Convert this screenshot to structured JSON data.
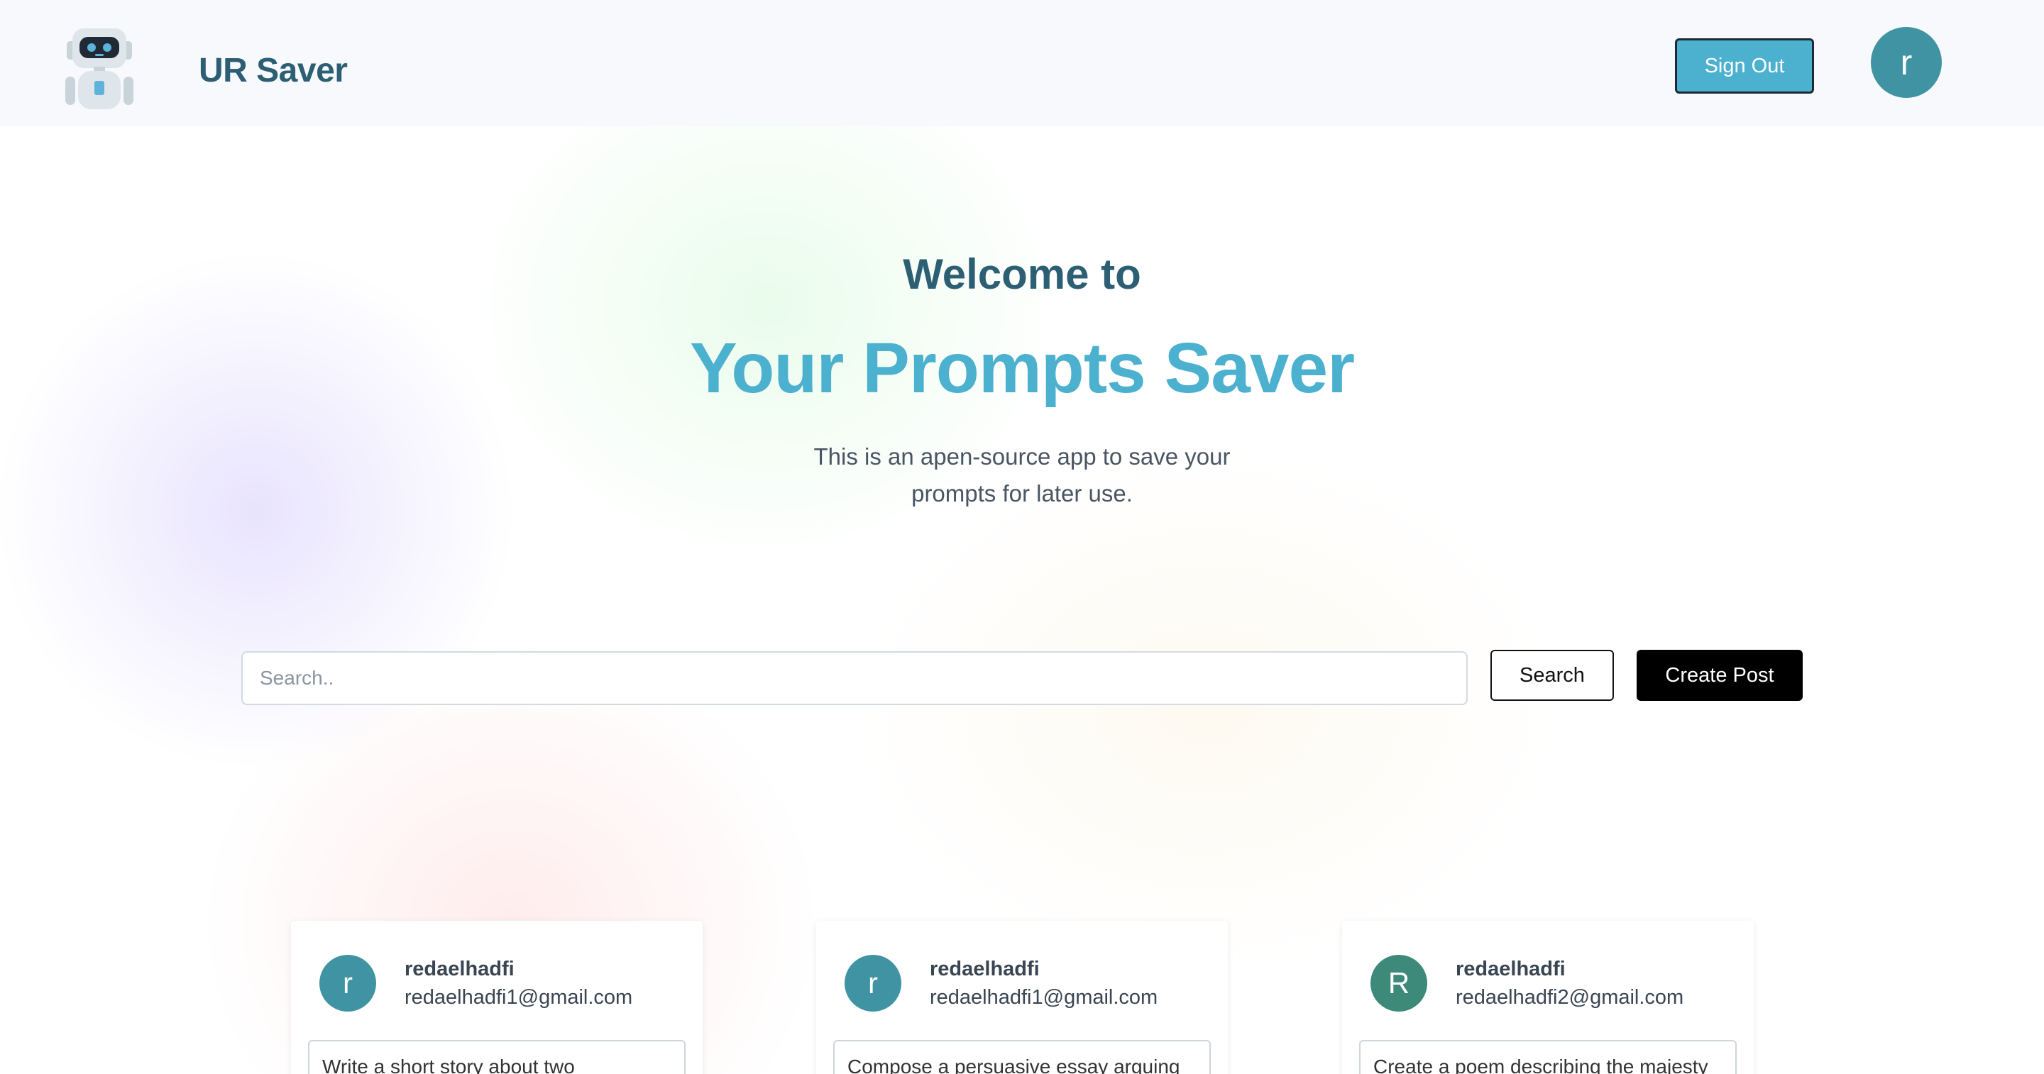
{
  "header": {
    "brand": "UR Saver",
    "logo_icon": "robot-icon",
    "sign_out_label": "Sign Out",
    "avatar_initial": "r"
  },
  "hero": {
    "welcome": "Welcome to",
    "title": "Your Prompts Saver",
    "description": "This is an apen-source app to save your prompts for later use."
  },
  "search": {
    "placeholder": "Search..",
    "value": "",
    "search_label": "Search",
    "create_label": "Create Post"
  },
  "posts": [
    {
      "avatar_initial": "r",
      "avatar_color": "#3f93a2",
      "username": "redaelhadfi",
      "email": "redaelhadfi1@gmail.com",
      "prompt": "Write a short story about two"
    },
    {
      "avatar_initial": "r",
      "avatar_color": "#3f93a2",
      "username": "redaelhadfi",
      "email": "redaelhadfi1@gmail.com",
      "prompt": "Compose a persuasive essay arguing"
    },
    {
      "avatar_initial": "R",
      "avatar_color": "#3d8a7a",
      "username": "redaelhadfi",
      "email": "redaelhadfi2@gmail.com",
      "prompt": "Create a poem describing the majesty"
    }
  ],
  "colors": {
    "brand_dark": "#2c5f73",
    "accent": "#4cb0cf",
    "primary_button": "#000000"
  }
}
